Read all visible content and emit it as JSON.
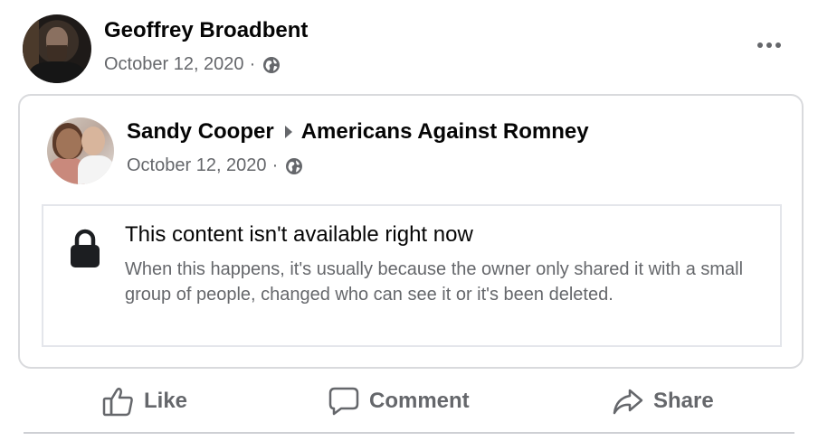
{
  "post": {
    "author_name": "Geoffrey Broadbent",
    "date": "October 12, 2020",
    "separator": "·",
    "privacy_icon": "globe-icon",
    "more_icon": "more-options-icon"
  },
  "shared_post": {
    "author_name": "Sandy Cooper",
    "group_name": "Americans Against Romney",
    "date": "October 12, 2020",
    "separator": "·",
    "privacy_icon": "globe-icon",
    "unavailable": {
      "icon": "lock-icon",
      "title": "This content isn't available right now",
      "message": "When this happens, it's usually because the owner only shared it with a small group of people, changed who can see it or it's been deleted."
    }
  },
  "actions": {
    "like_label": "Like",
    "comment_label": "Comment",
    "share_label": "Share"
  },
  "colors": {
    "text_primary": "#050505",
    "text_secondary": "#65676b",
    "border": "#d9dadd"
  }
}
